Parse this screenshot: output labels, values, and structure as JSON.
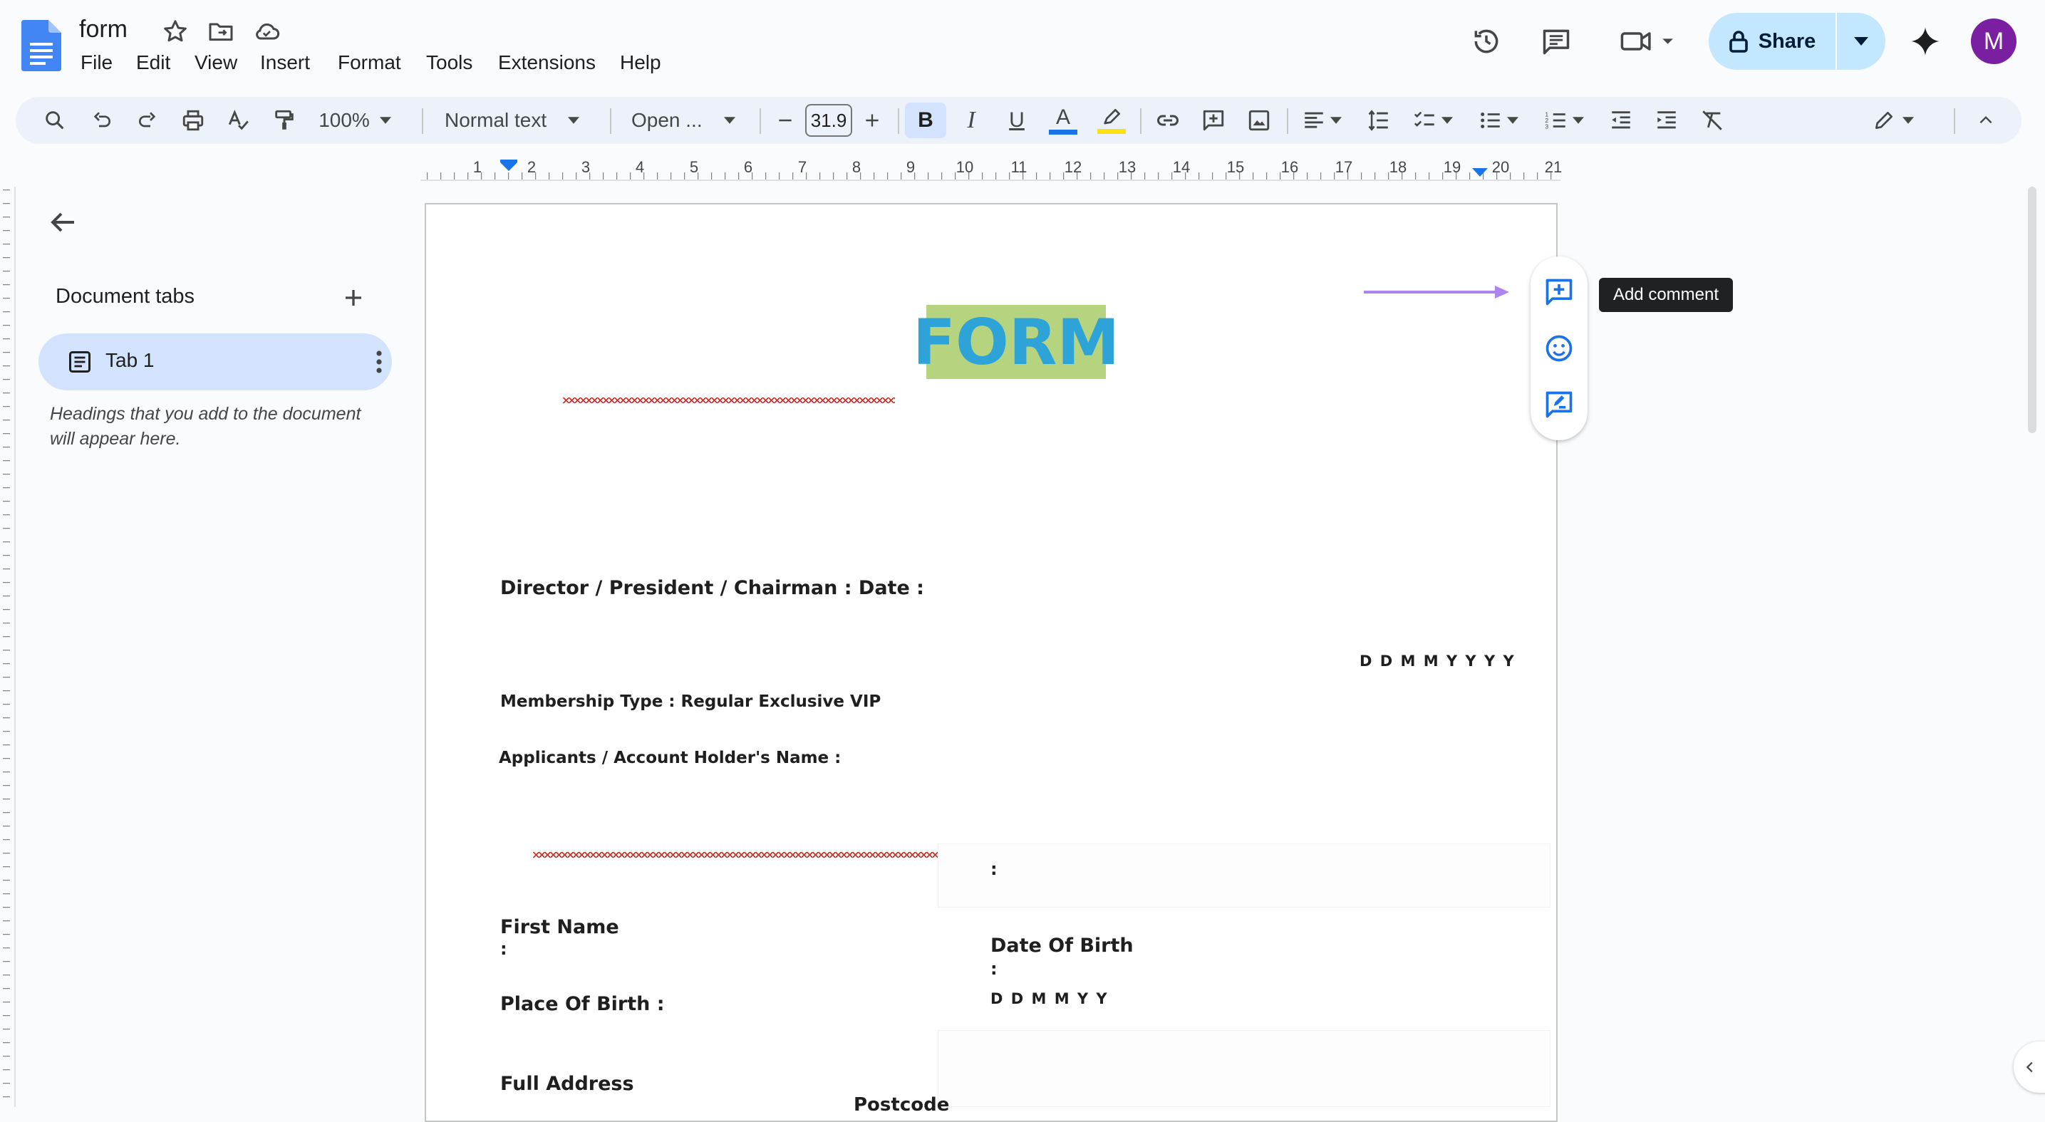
{
  "app": {
    "doc_title": "form",
    "menu": [
      "File",
      "Edit",
      "View",
      "Insert",
      "Format",
      "Tools",
      "Extensions",
      "Help"
    ],
    "share_label": "Share",
    "avatar_letter": "M"
  },
  "toolbar": {
    "zoom": "100%",
    "style": "Normal text",
    "font": "Open ...",
    "font_size": "31.9",
    "bold": "B",
    "italic": "I",
    "underline": "U",
    "text_color_glyph": "A",
    "text_color": "#1a73e8",
    "highlight_color": "#fbe014"
  },
  "ruler": {
    "numbers": [
      "1",
      "2",
      "3",
      "4",
      "5",
      "6",
      "7",
      "8",
      "9",
      "10",
      "11",
      "12",
      "13",
      "14",
      "15",
      "16",
      "17",
      "18",
      "19",
      "20",
      "21"
    ]
  },
  "sidebar": {
    "heading": "Document tabs",
    "tab_label": "Tab 1",
    "note": "Headings that you add to the document will appear here."
  },
  "document": {
    "title": "FORM",
    "title_text_color": "#2da3d8",
    "title_highlight": "#b6d37f",
    "director_line": "Director / President / Chairman : Date :",
    "date_format": "D D M M Y Y Y Y",
    "membership_line": "Membership Type : Regular Exclusive VIP",
    "applicant_line": "Applicants / Account Holder's Name :",
    "colon_mid": ":",
    "first_name": "First Name",
    "first_name_colon": ":",
    "dob_label": "Date Of Birth",
    "dob_colon": ":",
    "dob_format": "D D M M Y Y",
    "place_of_birth": "Place Of Birth :",
    "full_address": "Full Address",
    "postcode": "Postcode"
  },
  "comment_panel": {
    "tooltip": "Add comment",
    "accent": "#1a73e8",
    "arrow_color": "#b084f0"
  }
}
